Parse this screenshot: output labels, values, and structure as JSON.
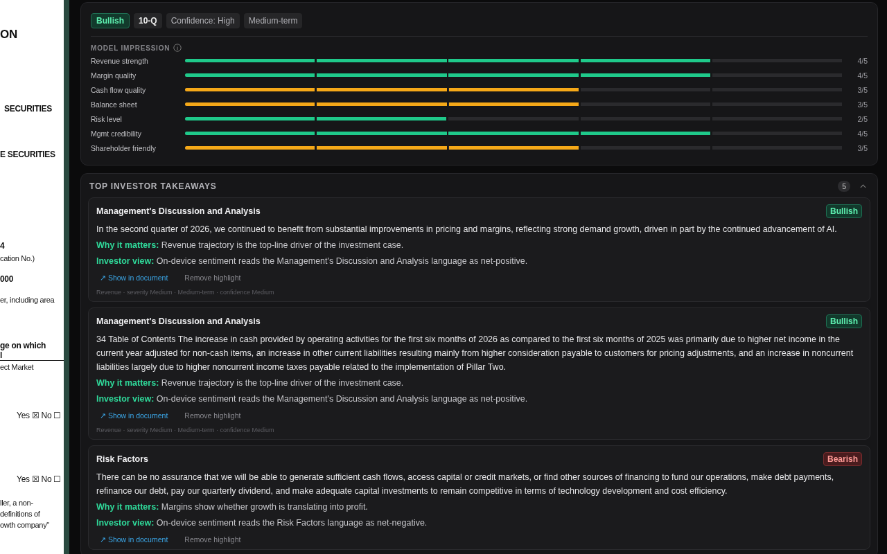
{
  "document": {
    "lines": [
      {
        "text": "ON",
        "kind": "heading"
      },
      {
        "text": "SECURITIES",
        "kind": "bold"
      },
      {
        "text": "E SECURITIES",
        "kind": "bold"
      },
      {
        "text": "4",
        "kind": "bold"
      },
      {
        "text": "cation No.)",
        "kind": "plain"
      },
      {
        "text": "000",
        "kind": "bold"
      },
      {
        "text": "er, including area",
        "kind": "plain"
      },
      {
        "text": "ge on which",
        "kind": "bold"
      },
      {
        "text": "l",
        "kind": "rule"
      },
      {
        "text": "ect Market",
        "kind": "plain"
      },
      {
        "text": "Yes ☒   No ☐",
        "kind": "check"
      },
      {
        "text": "Yes ☒   No ☐",
        "kind": "check"
      },
      {
        "text": "ller, a non-",
        "kind": "plain"
      },
      {
        "text": "definitions of",
        "kind": "plain"
      },
      {
        "text": "owth company\"",
        "kind": "plain"
      }
    ]
  },
  "summary": {
    "tags": [
      {
        "label": "Bullish",
        "kind": "sentiment"
      },
      {
        "label": "10-Q",
        "kind": "form"
      },
      {
        "label": "Confidence: High",
        "kind": "plain"
      },
      {
        "label": "Medium-term",
        "kind": "plain"
      }
    ],
    "impression_title": "MODEL IMPRESSION",
    "ratings": [
      {
        "label": "Revenue strength",
        "level": 0.8,
        "color": "#1fc98a",
        "score": "4/5"
      },
      {
        "label": "Margin quality",
        "level": 0.8,
        "color": "#1fc98a",
        "score": "4/5"
      },
      {
        "label": "Cash flow quality",
        "level": 0.6,
        "color": "#f5a818",
        "score": "3/5"
      },
      {
        "label": "Balance sheet",
        "level": 0.6,
        "color": "#f5a818",
        "score": "3/5"
      },
      {
        "label": "Risk level",
        "level": 0.4,
        "color": "#1fc98a",
        "score": "2/5"
      },
      {
        "label": "Mgmt credibility",
        "level": 0.8,
        "color": "#1fc98a",
        "score": "4/5"
      },
      {
        "label": "Shareholder friendly",
        "level": 0.6,
        "color": "#f5a818",
        "score": "3/5"
      }
    ]
  },
  "takeaways": {
    "title": "TOP INVESTOR TAKEAWAYS",
    "count": "5",
    "expanded": true,
    "items": [
      {
        "title": "Management's Discussion and Analysis",
        "sentiment": "Bullish",
        "kind": "bullish",
        "body": "In the second quarter of 2026, we continued to benefit from substantial improvements in pricing and margins, reflecting strong demand growth, driven in part by the continued advancement of AI.",
        "why_label": "Why it matters:",
        "why": "Revenue trajectory is the top-line driver of the investment case.",
        "view_label": "Investor view:",
        "view": "On-device sentiment reads the Management's Discussion and Analysis language as net-positive.",
        "show": "↗ Show in document",
        "remove": "Remove highlight",
        "meta": "Revenue · severity Medium · Medium-term · confidence Medium"
      },
      {
        "title": "Management's Discussion and Analysis",
        "sentiment": "Bullish",
        "kind": "bullish",
        "body": "34 Table of Contents The increase in cash provided by operating activities for the first six months of 2026 as compared to the first six months of 2025 was primarily due to higher net income in the current year adjusted for non-cash items, an increase in other current liabilities resulting mainly from higher consideration payable to customers for pricing adjustments, and an increase in noncurrent liabilities largely due to higher noncurrent income taxes payable related to the implementation of Pillar Two.",
        "why_label": "Why it matters:",
        "why": "Revenue trajectory is the top-line driver of the investment case.",
        "view_label": "Investor view:",
        "view": "On-device sentiment reads the Management's Discussion and Analysis language as net-positive.",
        "show": "↗ Show in document",
        "remove": "Remove highlight",
        "meta": "Revenue · severity Medium · Medium-term · confidence Medium"
      },
      {
        "title": "Risk Factors",
        "sentiment": "Bearish",
        "kind": "bearish",
        "body": "There can be no assurance that we will be able to generate sufficient cash flows, access capital or credit markets, or find other sources of financing to fund our operations, make debt payments, refinance our debt, pay our quarterly dividend, and make adequate capital investments to remain competitive in terms of technology development and cost efficiency.",
        "why_label": "Why it matters:",
        "why": "Margins show whether growth is translating into profit.",
        "view_label": "Investor view:",
        "view": "On-device sentiment reads the Risk Factors language as net-negative.",
        "show": "↗ Show in document",
        "remove": "Remove highlight"
      }
    ]
  }
}
